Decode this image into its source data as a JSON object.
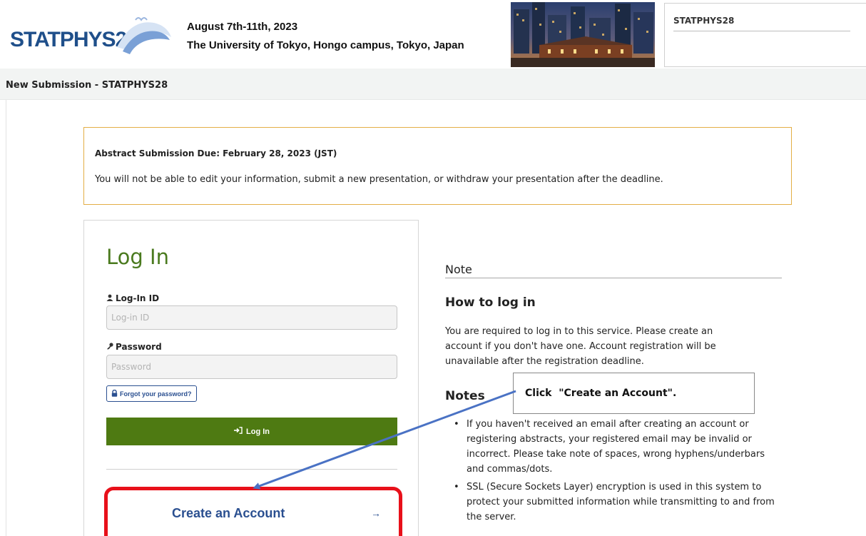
{
  "header": {
    "logo_text": "STATPHYS28",
    "event_dates": "August 7th-11th, 2023",
    "event_venue": "The University of Tokyo, Hongo campus, Tokyo, Japan",
    "site_name": "STATPHYS28"
  },
  "page": {
    "title": "New Submission - STATPHYS28"
  },
  "notice": {
    "title": "Abstract Submission Due: February 28, 2023 (JST)",
    "body": "You will not be able to edit your information, submit a new presentation, or withdraw your presentation after the deadline."
  },
  "login": {
    "heading": "Log In",
    "login_id_label": "Log-In ID",
    "login_id_placeholder": "Log-in ID",
    "login_id_value": "",
    "password_label": "Password",
    "password_placeholder": "Password",
    "password_value": "",
    "forgot_label": "Forgot your password?",
    "login_button": "Log In",
    "create_account": "Create an Account"
  },
  "note": {
    "heading": "Note",
    "howto_heading": "How to log in",
    "howto_body": "You are required to log in to this service. Please create an account if you don't have one. Account registration will be unavailable after the registration deadline.",
    "notes_heading": "Notes",
    "notes": [
      "If you haven't received an email after creating an account or registering abstracts, your registered email may be invalid or incorrect. Please take note of spaces, wrong hyphens/underbars and commas/dots.",
      "SSL (Secure Sockets Layer) encryption is used in this system to protect your submitted information while transmitting to and from the server."
    ]
  },
  "annotation": {
    "callout_text": "Click  \"Create an Account\"."
  },
  "colors": {
    "brand_blue": "#2a4f90",
    "login_green": "#4e7a12",
    "heading_green": "#4a7a1e",
    "notice_border": "#e3ae45",
    "highlight_red": "#e8101a",
    "arrow_blue": "#4a72c4"
  },
  "icons": {
    "login_id": "user-icon",
    "password": "key-icon",
    "forgot": "lock-icon",
    "login": "sign-in-icon",
    "create": "arrow-right-icon"
  }
}
